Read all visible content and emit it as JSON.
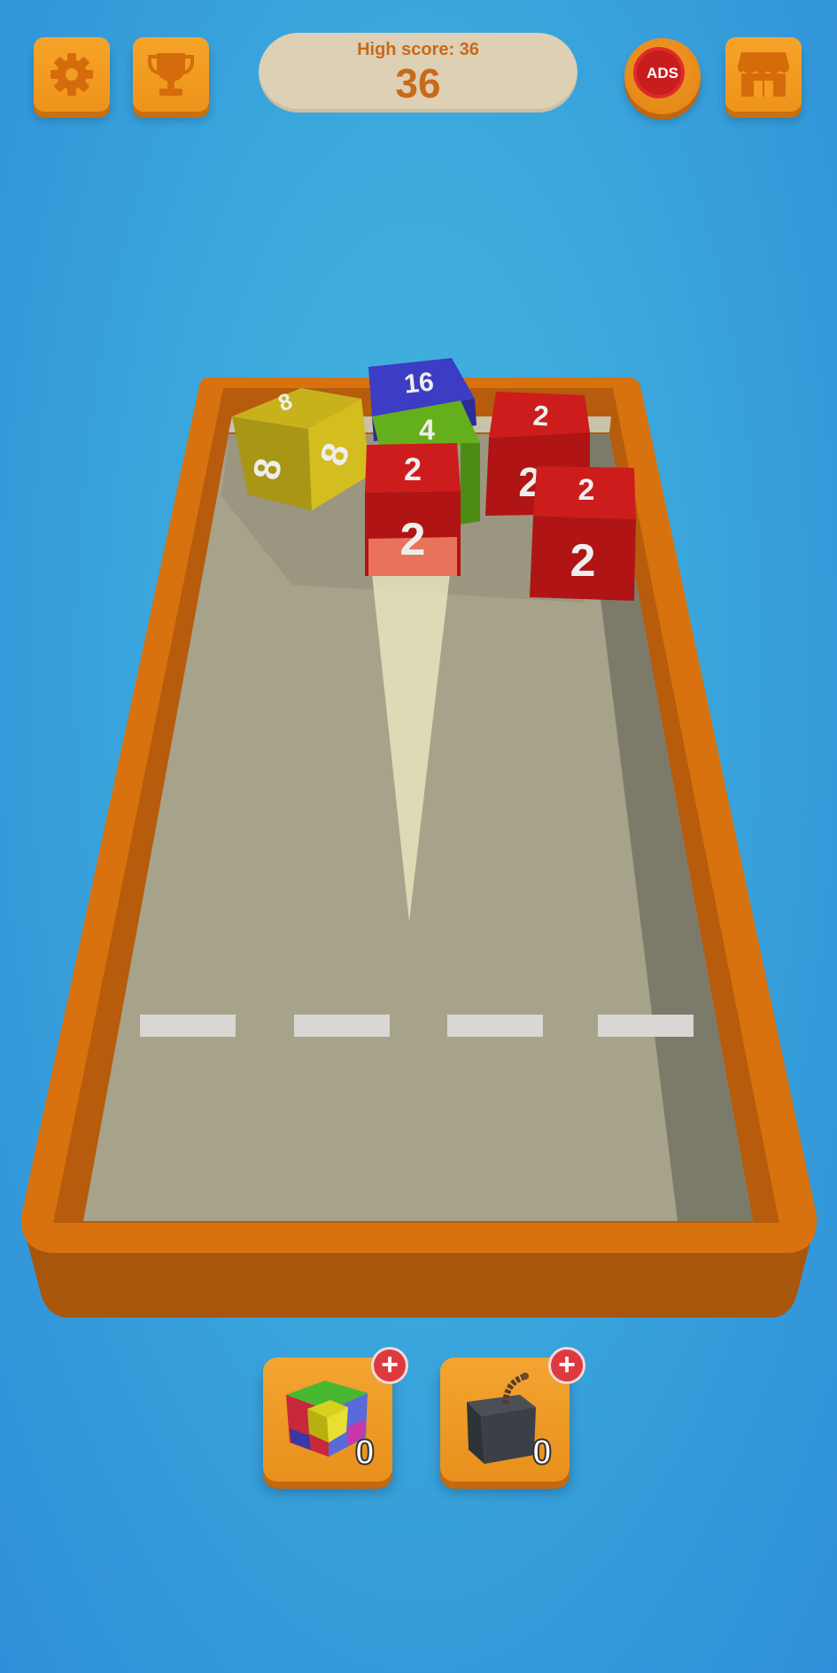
{
  "hud": {
    "high_score_label": "High score: 36",
    "score": "36",
    "no_ads_label": "ADS"
  },
  "board": {
    "cubes": [
      {
        "value": "16",
        "color": "#3f3fc8"
      },
      {
        "value": "8",
        "color": "#c8b21c"
      },
      {
        "value": "4",
        "color": "#5aa818"
      },
      {
        "value": "2",
        "color": "#c81818"
      },
      {
        "value": "2",
        "color": "#c81818"
      },
      {
        "value": "2",
        "color": "#c81818"
      }
    ]
  },
  "powerups": [
    {
      "name": "color-cube",
      "count": "0",
      "add_label": "+"
    },
    {
      "name": "bomb",
      "count": "0",
      "add_label": "+"
    }
  ]
}
